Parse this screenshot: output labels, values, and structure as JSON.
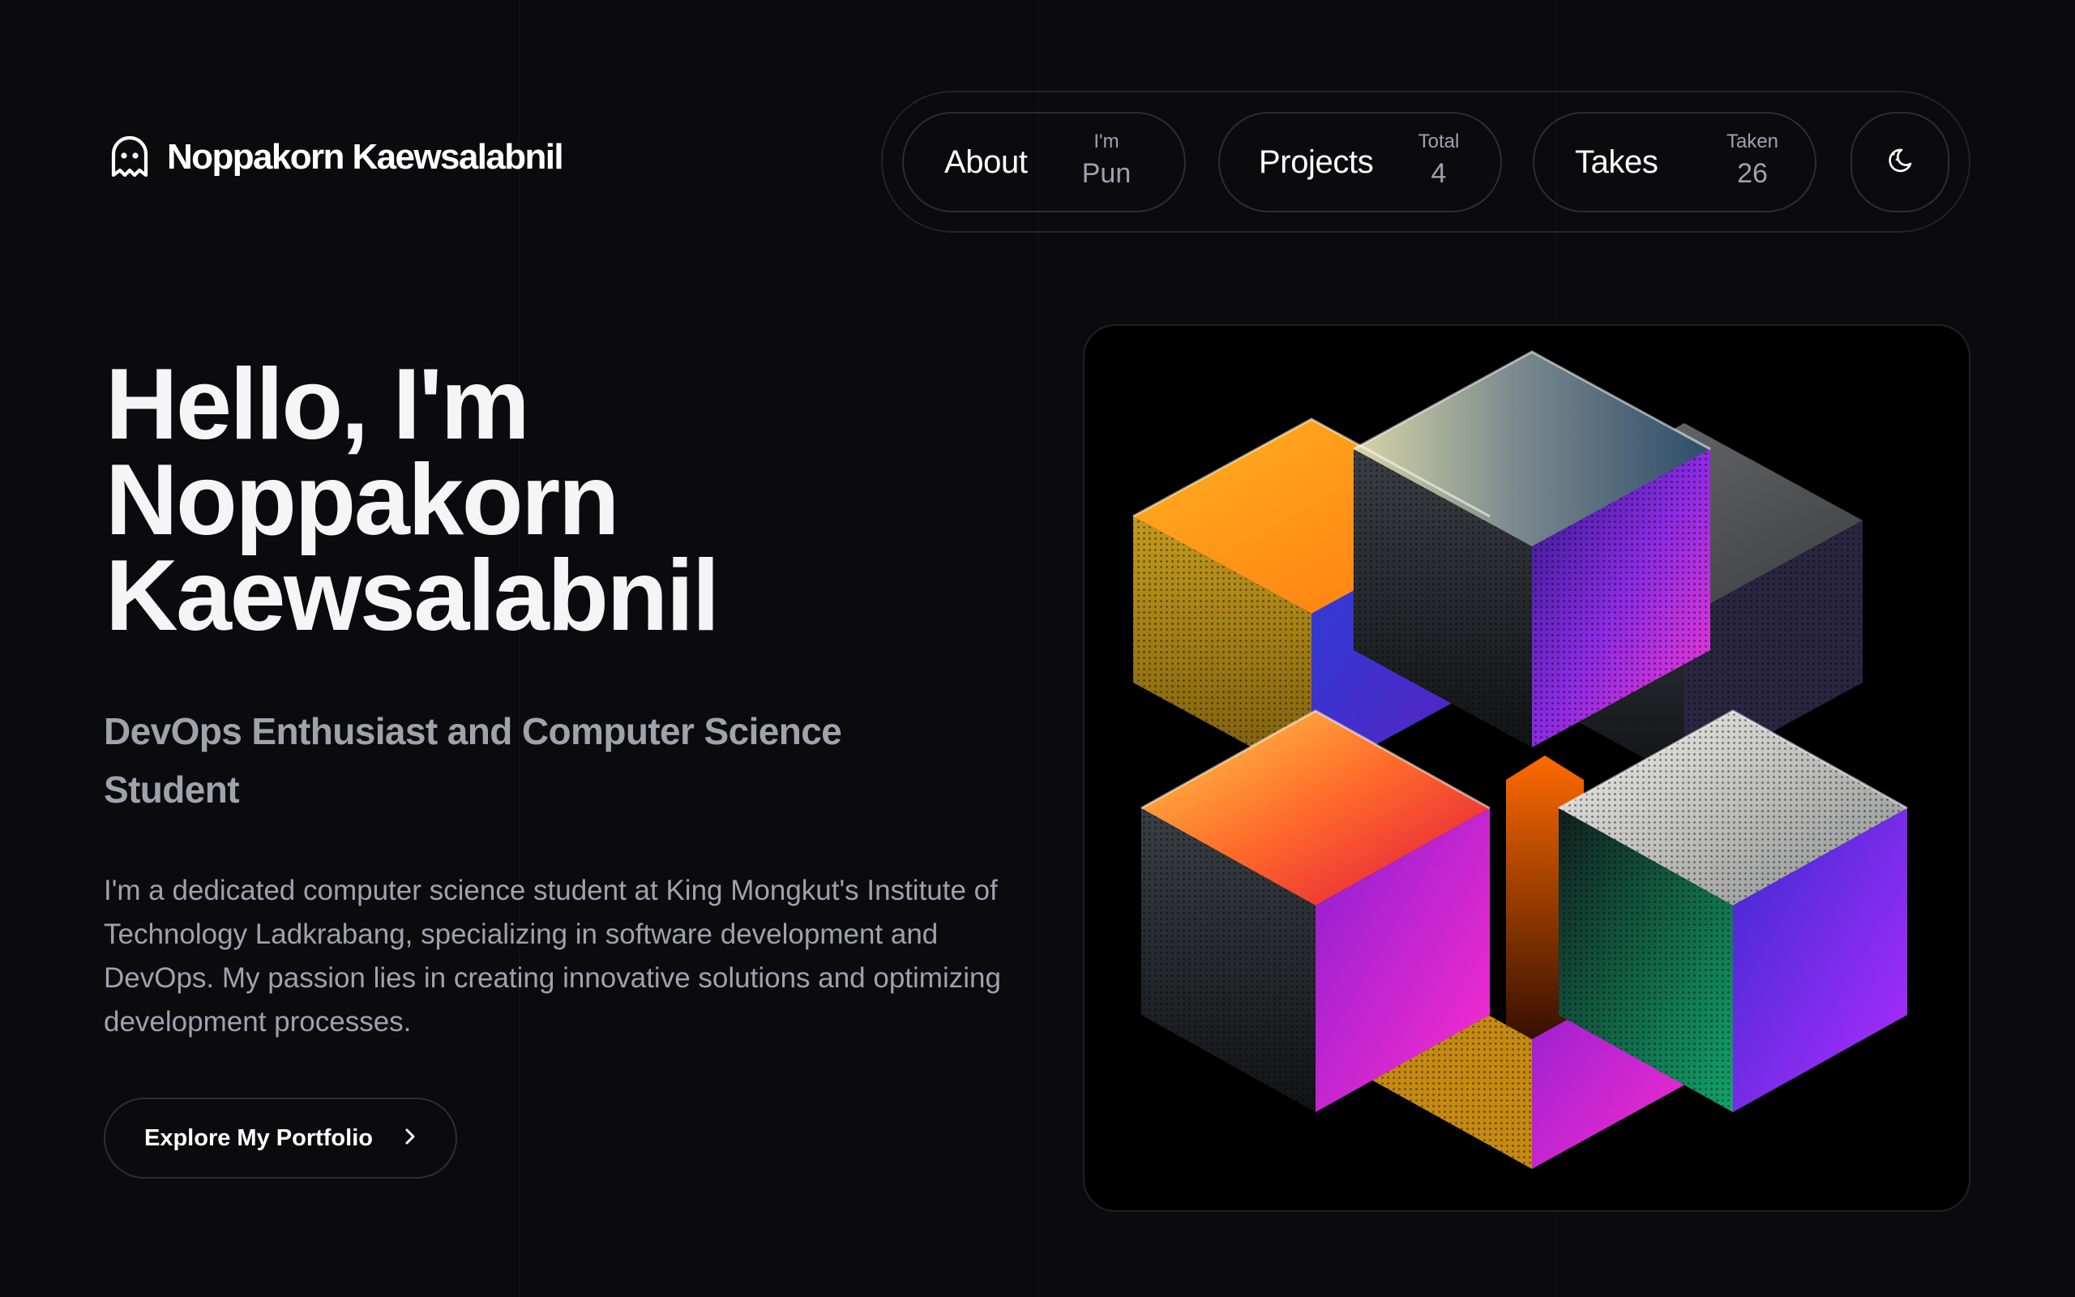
{
  "brand": {
    "name": "Noppakorn Kaewsalabnil",
    "icon": "ghost-icon"
  },
  "nav": {
    "items": [
      {
        "label": "About",
        "meta_label": "I'm",
        "meta_value": "Pun"
      },
      {
        "label": "Projects",
        "meta_label": "Total",
        "meta_value": "4"
      },
      {
        "label": "Takes",
        "meta_label": "Taken",
        "meta_value": "26"
      }
    ],
    "theme_toggle_icon": "moon-icon"
  },
  "hero": {
    "title_lines": [
      "Hello, I'm",
      "Noppakorn",
      "Kaewsalabnil"
    ],
    "subtitle": "DevOps Enthusiast and Computer Science Student",
    "description": "I'm a dedicated computer science student at King Mongkut's Institute of Technology Ladkrabang, specializing in software development and DevOps. My passion lies in creating innovative solutions and optimizing development processes.",
    "cta_label": "Explore My Portfolio",
    "cta_icon": "chevron-right-icon"
  }
}
